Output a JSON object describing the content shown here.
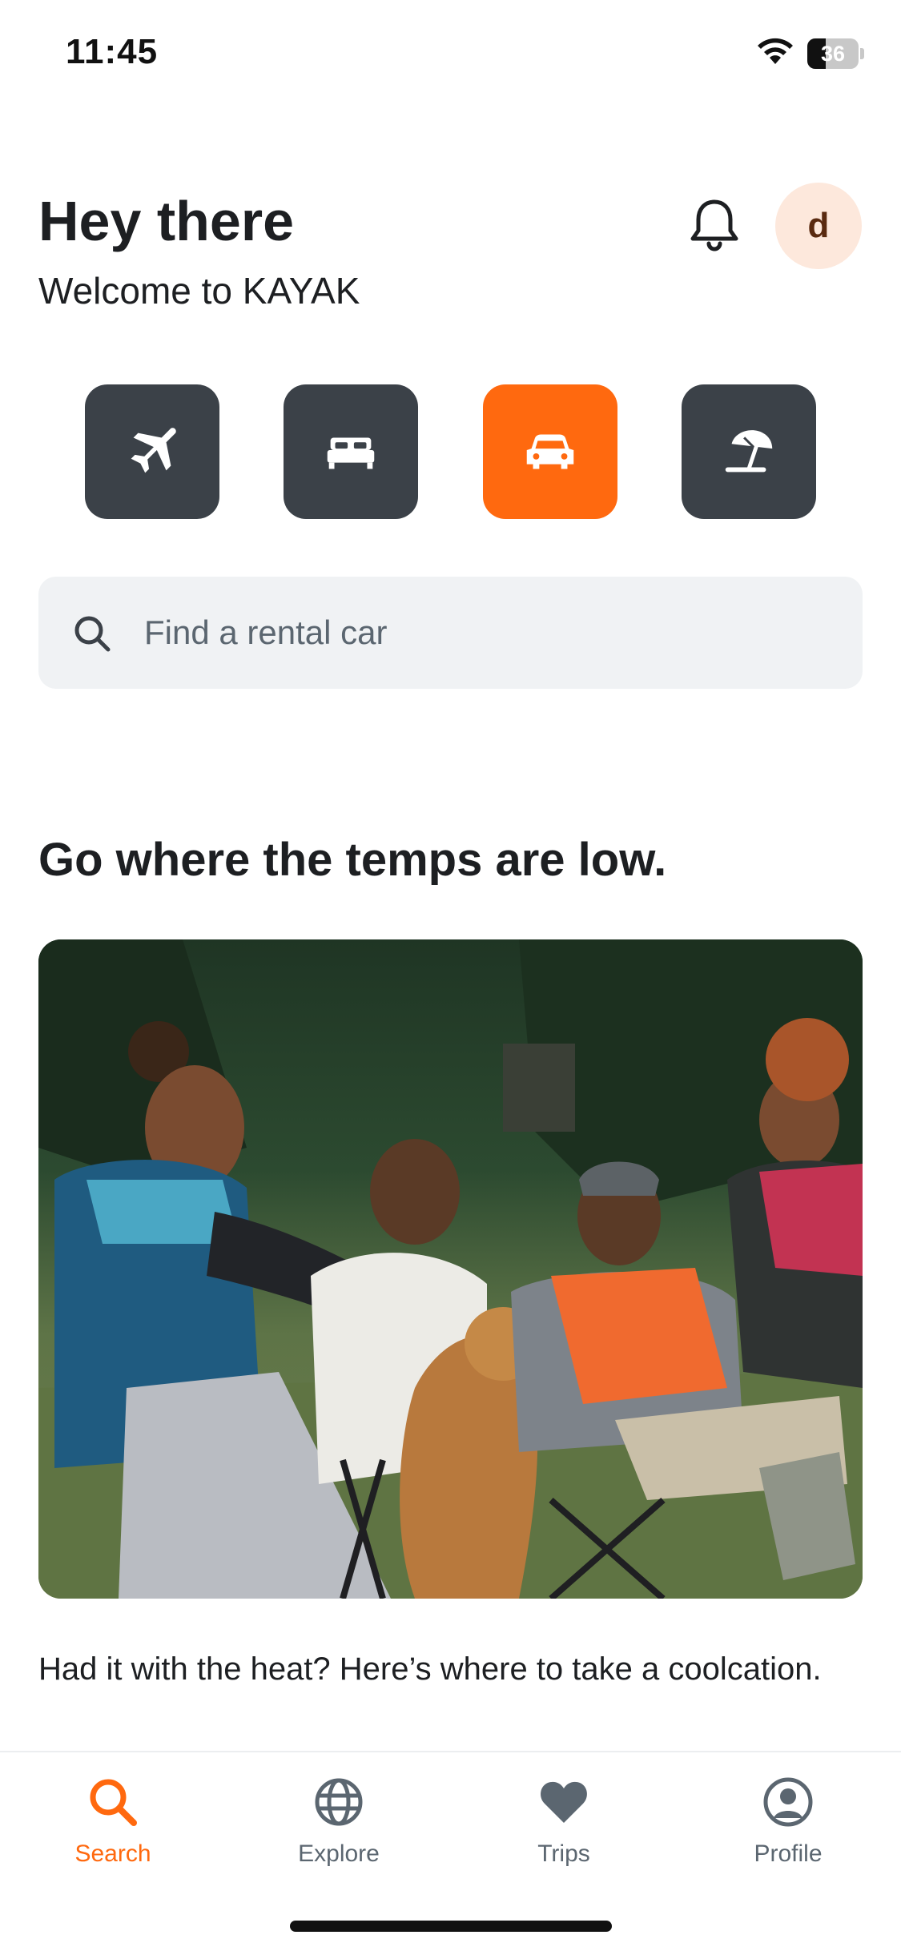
{
  "status_bar": {
    "time": "11:45",
    "battery_level": "36",
    "battery_fraction": 0.36,
    "icons": [
      "wifi-icon",
      "battery-icon"
    ]
  },
  "header": {
    "title": "Hey there",
    "subtitle": "Welcome to KAYAK",
    "avatar_letter": "d",
    "icons": [
      "bell-icon"
    ]
  },
  "verticals": [
    {
      "icon": "airplane-icon",
      "active": false
    },
    {
      "icon": "bed-icon",
      "active": false
    },
    {
      "icon": "car-icon",
      "active": true
    },
    {
      "icon": "beach-umbrella-icon",
      "active": false
    }
  ],
  "search": {
    "placeholder": "Find a rental car",
    "icon": "search-icon"
  },
  "promo": {
    "title": "Go where the temps are low.",
    "caption": "Had it with the heat? Here’s where to take a coolcation."
  },
  "tab_bar": {
    "tabs": [
      {
        "label": "Search",
        "icon": "search-icon",
        "active": true
      },
      {
        "label": "Explore",
        "icon": "globe-icon",
        "active": false
      },
      {
        "label": "Trips",
        "icon": "heart-icon",
        "active": false
      },
      {
        "label": "Profile",
        "icon": "user-circle-icon",
        "active": false
      }
    ]
  },
  "colors": {
    "accent": "#ff690f",
    "tile_dark": "#3b4148",
    "search_bg": "#f0f2f4",
    "text_primary": "#1d1f22",
    "text_secondary": "#5b6670",
    "avatar_bg": "#fde8dc"
  }
}
